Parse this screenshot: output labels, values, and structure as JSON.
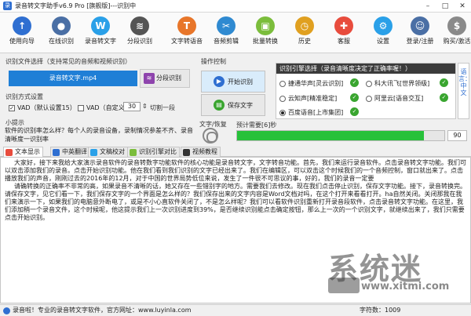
{
  "window": {
    "title": "录音转文字助手v6.9 Pro [旗舰版]---识别中",
    "controls": [
      "–",
      "□",
      "✕"
    ]
  },
  "toolbar": {
    "items": [
      {
        "label": "使用向导",
        "icon": "rocket-icon",
        "glyph": "↑",
        "color": "#2f6fd1"
      },
      {
        "label": "在线识别",
        "icon": "microphone-icon",
        "glyph": "●",
        "color": "#4a6fa5"
      },
      {
        "label": "录音转文字",
        "icon": "w-logo-icon",
        "glyph": "W",
        "color": "#2aa0e8"
      },
      {
        "label": "分段识别",
        "icon": "waveform-icon",
        "glyph": "≋",
        "color": "#555555"
      },
      {
        "label": "文字转语音",
        "icon": "text-speech-icon",
        "glyph": "T",
        "color": "#e8762a"
      },
      {
        "label": "音频剪辑",
        "icon": "scissors-icon",
        "glyph": "✂",
        "color": "#2f8ad1"
      },
      {
        "label": "批量转换",
        "icon": "folder-icon",
        "glyph": "▣",
        "color": "#7bbd3c"
      },
      {
        "label": "历史",
        "icon": "history-icon",
        "glyph": "◷",
        "color": "#e0a020"
      },
      {
        "label": "客服",
        "icon": "support-icon",
        "glyph": "✚",
        "color": "#e84c3d"
      },
      {
        "label": "设置",
        "icon": "gear-icon",
        "glyph": "⚙",
        "color": "#2aa0e8"
      },
      {
        "label": "登录/注册",
        "icon": "user-icon",
        "glyph": "☺",
        "color": "#4a6fa5"
      },
      {
        "label": "购买/激活",
        "icon": "purchase-icon",
        "glyph": "$",
        "color": "#8a8a8a"
      }
    ]
  },
  "file_section": {
    "label": "识别文件选择（支持常见的音频和视频识别）",
    "filename": "录音转文字.mp4",
    "split_button": "分段识别"
  },
  "mode_section": {
    "label": "识别方式设置",
    "vad_default": "VAD（默认设置15）",
    "vad_custom": "VAD（自定义）",
    "custom_value": "30",
    "custom_suffix": "切割一段"
  },
  "hint": {
    "label": "小提示",
    "text": "软件的识别率怎么样？每个人的录音设备，录制情况参差不齐、录音清晰度一识别率"
  },
  "operation": {
    "label": "操作控制",
    "start_button": "开始识别",
    "save_button": "保存文字"
  },
  "engine": {
    "header": "识别引擎选择（录音清晰度决定了正确率喔！）",
    "options": [
      {
        "label": "捷通华声[灵云识别]",
        "selected": false
      },
      {
        "label": "科大讯飞[世界领级]",
        "selected": false
      },
      {
        "label": "云知声[精准稳定]",
        "selected": false
      },
      {
        "label": "阿里云[语音交互]",
        "selected": false
      },
      {
        "label": "百度语音[上市集团]",
        "selected": true
      }
    ],
    "side_label": "语言：中文",
    "side_sub": "识别引擎"
  },
  "progress": {
    "voice_label": "文字/恢复",
    "label": "预计需要[6]秒",
    "value": 90,
    "display": "90"
  },
  "tabs": [
    {
      "label": "文本显示",
      "icon_color": "#e84c3d",
      "active": true
    },
    {
      "label": "中英翻译",
      "icon_color": "#2f6fd1",
      "active": false
    },
    {
      "label": "文稿校对",
      "icon_color": "#2aa0e8",
      "active": false
    },
    {
      "label": "识别引擎对比",
      "icon_color": "#7bbd3c",
      "active": false
    },
    {
      "label": "视频教程",
      "icon_color": "#333333",
      "active": false
    }
  ],
  "transcript": [
    "大家好，接下来我给大家演示录音软件的录音转数字功能软件的核心功能是录音转文字，文字转音功能。首先，我们来运行录音软件。点击录音转文字功能。我们可以双击添加我们的录音。点击开始识别功能。他在我们看到我们识别的文字已经出来了。我们在编辑区，可以双击这个时候我们的一个音频控制，窗口就出来了。点击播放我们的声音，刚刚过去的2016年的12月，对于中国的世界局势低位来说，发生了一件很不可思议的事，好的，我们的录音一定要",
    "请确转换的正确率不非常的高，如果录音不清晰的话，她又存在一些错别字的地方。需要我们去修改。现在我们点击停止识别，保存文字功能。接下，录音转换完。请保存文字，见它们看一下，我们保存文字的一个界面是怎么样的？我们保存出来的文字内容是Word文档对吗，在这个打开来看看打开。ha自然关闭。关闭那我在我们来演示一下，如果我们的电脑意外断电了，或是不小心直软件关闭了，不是怎么样呢？我们可以看软件识别重新打开录音段软件，点击录音转文字功能。在这里，我们添加稍一个录音文件，这个时候呢，他这提示我们上一次识别进度到39%，是否继续识别能点击确定按钮，那么上一次的一个识别文字，就继续出来了，我们只需要点击开始识别。"
  ],
  "watermark": {
    "brand": "系统迷",
    "url": "www.xitmi.com"
  },
  "statusbar": {
    "text": "录音啦！专业的录音转文字软件，官方网址：www.luyinla.com",
    "count": "字符数：1009"
  }
}
